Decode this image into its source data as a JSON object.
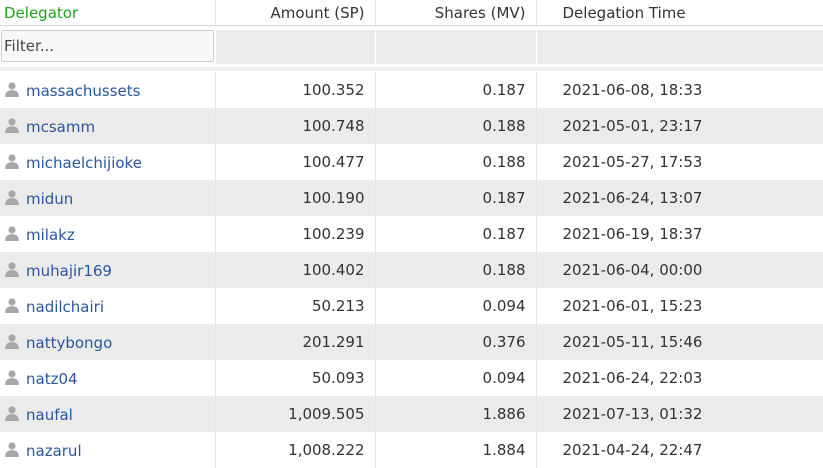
{
  "headers": {
    "delegator": "Delegator",
    "amount": "Amount (SP)",
    "shares": "Shares (MV)",
    "time": "Delegation Time"
  },
  "filter": {
    "placeholder": "Filter..."
  },
  "rows": [
    {
      "user": "massachussets",
      "amount": "100.352",
      "shares": "0.187",
      "time": "2021-06-08, 18:33"
    },
    {
      "user": "mcsamm",
      "amount": "100.748",
      "shares": "0.188",
      "time": "2021-05-01, 23:17"
    },
    {
      "user": "michaelchijioke",
      "amount": "100.477",
      "shares": "0.188",
      "time": "2021-05-27, 17:53"
    },
    {
      "user": "midun",
      "amount": "100.190",
      "shares": "0.187",
      "time": "2021-06-24, 13:07"
    },
    {
      "user": "milakz",
      "amount": "100.239",
      "shares": "0.187",
      "time": "2021-06-19, 18:37"
    },
    {
      "user": "muhajir169",
      "amount": "100.402",
      "shares": "0.188",
      "time": "2021-06-04, 00:00"
    },
    {
      "user": "nadilchairi",
      "amount": "50.213",
      "shares": "0.094",
      "time": "2021-06-01, 15:23"
    },
    {
      "user": "nattybongo",
      "amount": "201.291",
      "shares": "0.376",
      "time": "2021-05-11, 15:46"
    },
    {
      "user": "natz04",
      "amount": "50.093",
      "shares": "0.094",
      "time": "2021-06-24, 22:03"
    },
    {
      "user": "naufal",
      "amount": "1,009.505",
      "shares": "1.886",
      "time": "2021-07-13, 01:32"
    },
    {
      "user": "nazarul",
      "amount": "1,008.222",
      "shares": "1.884",
      "time": "2021-04-24, 22:47"
    }
  ],
  "icons": {
    "user": "user-icon"
  },
  "colors": {
    "header_active": "#1fa21f",
    "link": "#2a56a0",
    "stripe": "#ebebeb"
  }
}
